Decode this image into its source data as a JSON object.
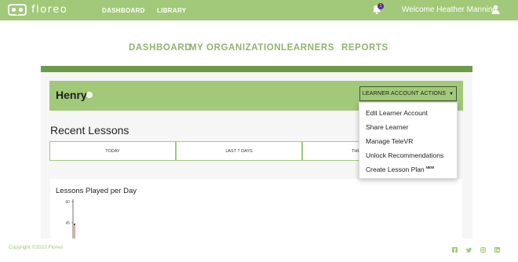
{
  "header": {
    "brand": "floreo",
    "nav": [
      "DASHBOARD",
      "LIBRARY"
    ],
    "notification_count": "1",
    "welcome": "Welcome Heather Manning"
  },
  "subnav": [
    "DASHBOARD",
    "MY ORGANIZATION",
    "LEARNERS",
    "REPORTS"
  ],
  "learner": {
    "name": "Henry",
    "actions_label": "LEARNER ACCOUNT ACTIONS"
  },
  "dropdown": {
    "items": [
      "Edit Learner Account",
      "Share Learner",
      "Manage TeleVR",
      "Unlock Recommendations",
      "Create Lesson Plan"
    ],
    "new_badge": "NEW"
  },
  "recent_lessons": {
    "title": "Recent Lessons",
    "tabs": [
      "TODAY",
      "LAST 7 DAYS",
      "THE"
    ]
  },
  "chart_data": {
    "type": "bar",
    "title": "Lessons Played per Day",
    "y_ticks": [
      "60",
      "45"
    ],
    "xlabel": "",
    "ylabel": ""
  },
  "footer": {
    "copyright": "Copyright ©2022 Floreo",
    "social_icons": [
      "facebook-icon",
      "twitter-icon",
      "instagram-icon",
      "linkedin-icon"
    ]
  },
  "colors": {
    "brand_green": "#a2c97a",
    "dark_green": "#6f9a4a",
    "badge_purple": "#5a2a8a"
  }
}
